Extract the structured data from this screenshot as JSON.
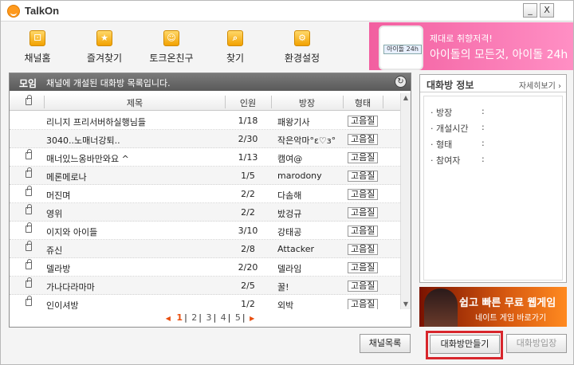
{
  "app": {
    "title": "TalkOn"
  },
  "window_controls": {
    "minimize": "_",
    "close": "X"
  },
  "toolbar": [
    {
      "label": "채널홈",
      "icon": "channel-home-icon",
      "glyph": "⚀"
    },
    {
      "label": "즐겨찾기",
      "icon": "star-icon",
      "glyph": "★"
    },
    {
      "label": "토크온친구",
      "icon": "friend-face-icon",
      "glyph": "☺"
    },
    {
      "label": "찾기",
      "icon": "search-icon",
      "glyph": "⌕"
    },
    {
      "label": "환경설정",
      "icon": "gear-icon",
      "glyph": "⚙"
    }
  ],
  "top_banner": {
    "line1": "제대로 취향저격!",
    "line2": "아이돌의 모든것, 아이돌 24h",
    "phone_tag": "아이돌 24h"
  },
  "room_list": {
    "category": "모임",
    "description": "채널에 개설된 대화방 목록입니다.",
    "columns": {
      "title": "제목",
      "members": "인원",
      "host": "방장",
      "type": "형태"
    },
    "rows": [
      {
        "locked": false,
        "title": "리니지 프리서버하실행님들",
        "members": "1/18",
        "host": "패왕기사",
        "type": "고음질"
      },
      {
        "locked": false,
        "title": "3040..노매너강퇴..",
        "members": "2/30",
        "host": "작은악마°ε♡з°",
        "type": "고음질"
      },
      {
        "locked": true,
        "title": "매너있느옹바만와요 ^",
        "members": "1/13",
        "host": "캠여@",
        "type": "고음질"
      },
      {
        "locked": true,
        "title": "메론메로나",
        "members": "1/5",
        "host": "marodony",
        "type": "고음질"
      },
      {
        "locked": true,
        "title": "머진며",
        "members": "2/2",
        "host": "다솜해",
        "type": "고음질"
      },
      {
        "locked": true,
        "title": "영위",
        "members": "2/2",
        "host": "밨겅규",
        "type": "고음질"
      },
      {
        "locked": true,
        "title": "이지와 아이들",
        "members": "3/10",
        "host": "강태공",
        "type": "고음질"
      },
      {
        "locked": true,
        "title": "쥬신",
        "members": "2/8",
        "host": "Attacker",
        "type": "고음질"
      },
      {
        "locked": true,
        "title": "델라방",
        "members": "2/20",
        "host": "델라임",
        "type": "고음질"
      },
      {
        "locked": true,
        "title": "가나다라마마",
        "members": "2/5",
        "host": "꿀!",
        "type": "고음질"
      },
      {
        "locked": true,
        "title": "인이셔방",
        "members": "1/2",
        "host": "외박",
        "type": "고음질"
      }
    ],
    "pagination": {
      "prev": "◀",
      "pages": [
        "1",
        "2",
        "3",
        "4",
        "5"
      ],
      "current": "1",
      "next": "▶"
    }
  },
  "room_info": {
    "title": "대화방 정보",
    "more_link": "자세히보기 ›",
    "fields": [
      {
        "key": "· 방장",
        "sep": ":"
      },
      {
        "key": "· 개설시간",
        "sep": ":"
      },
      {
        "key": "· 형태",
        "sep": ":"
      },
      {
        "key": "· 참여자",
        "sep": ":"
      }
    ]
  },
  "bottom_banner": {
    "line1": "쉽고 빠른 무료 웹게임",
    "line2": "네이트 게임 바로가기"
  },
  "buttons": {
    "channel_list": "채널목록",
    "create_room": "대화방만들기",
    "enter_room": "대화방입장"
  },
  "colors": {
    "accent": "#e84e0f",
    "highlight": "#d8262c"
  }
}
